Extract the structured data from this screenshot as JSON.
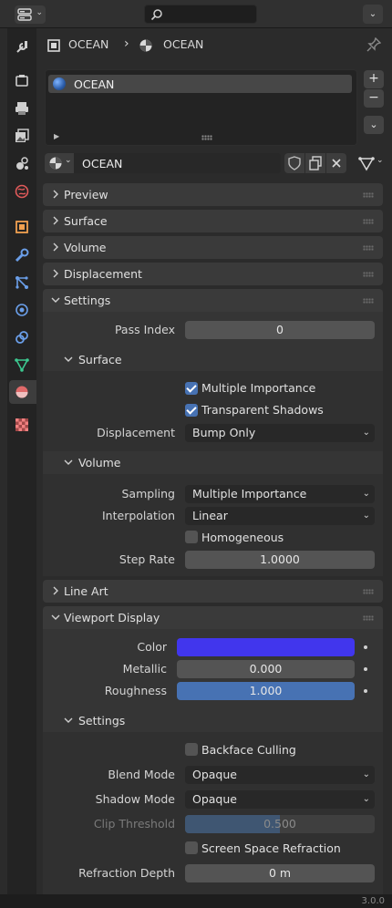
{
  "breadcrumb": {
    "object_name": "OCEAN",
    "material_name": "OCEAN"
  },
  "material_slots": {
    "items": [
      {
        "name": "OCEAN"
      }
    ],
    "add_label": "+",
    "remove_label": "−",
    "more_label": "⌄"
  },
  "material_selector": {
    "name": "OCEAN"
  },
  "panels": {
    "preview": "Preview",
    "surface": "Surface",
    "volume": "Volume",
    "displacement": "Displacement",
    "settings": "Settings",
    "line_art": "Line Art",
    "viewport_display": "Viewport Display"
  },
  "settings": {
    "pass_index_label": "Pass Index",
    "pass_index_value": "0",
    "surface_title": "Surface",
    "multiple_importance_label": "Multiple Importance",
    "multiple_importance_checked": true,
    "transparent_shadows_label": "Transparent Shadows",
    "transparent_shadows_checked": true,
    "displacement_label": "Displacement",
    "displacement_value": "Bump Only",
    "volume_title": "Volume",
    "sampling_label": "Sampling",
    "sampling_value": "Multiple Importance",
    "interpolation_label": "Interpolation",
    "interpolation_value": "Linear",
    "homogeneous_label": "Homogeneous",
    "homogeneous_checked": false,
    "step_rate_label": "Step Rate",
    "step_rate_value": "1.0000"
  },
  "viewport_display": {
    "color_label": "Color",
    "color_value": "#4136ed",
    "metallic_label": "Metallic",
    "metallic_value": "0.000",
    "roughness_label": "Roughness",
    "roughness_value": "1.000",
    "settings_title": "Settings",
    "backface_culling_label": "Backface Culling",
    "backface_culling_checked": false,
    "blend_mode_label": "Blend Mode",
    "blend_mode_value": "Opaque",
    "shadow_mode_label": "Shadow Mode",
    "shadow_mode_value": "Opaque",
    "clip_threshold_label": "Clip Threshold",
    "clip_threshold_value": "0.500",
    "clip_threshold_fraction": 0.5,
    "ssr_label": "Screen Space Refraction",
    "ssr_checked": false,
    "refraction_depth_label": "Refraction Depth",
    "refraction_depth_value": "0 m"
  },
  "footer": {
    "version": "3.0.0"
  },
  "colors": {
    "accent": "#4772b3",
    "panel_header": "#3a3a3a",
    "background": "#2b2b2b"
  }
}
